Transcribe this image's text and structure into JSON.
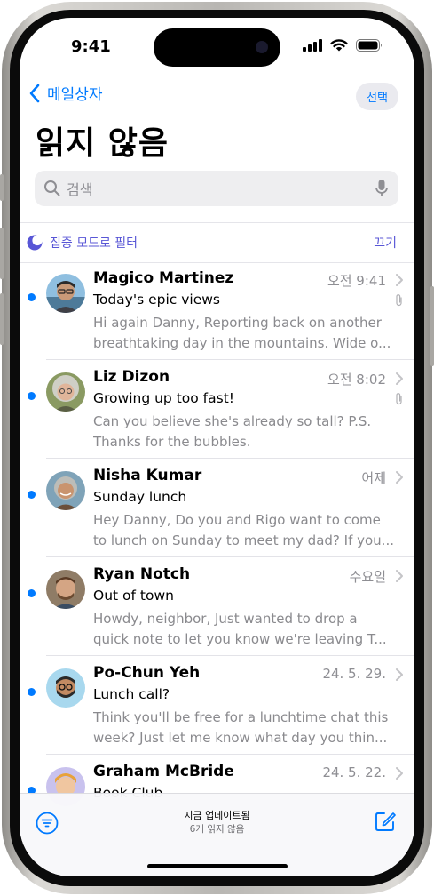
{
  "status": {
    "time": "9:41"
  },
  "nav": {
    "back_label": "메일상자",
    "select_label": "선택",
    "title": "읽지 않음"
  },
  "search": {
    "placeholder": "검색"
  },
  "focus_filter": {
    "label": "집중 모드로 필터",
    "off_label": "끄기"
  },
  "messages": [
    {
      "sender": "Magico Martinez",
      "date": "오전 9:41",
      "subject": "Today's epic views",
      "preview1": "Hi again Danny, Reporting back on another",
      "preview2": "breathtaking day in the mountains. Wide o...",
      "unread": true,
      "attachment": true
    },
    {
      "sender": "Liz Dizon",
      "date": "오전 8:02",
      "subject": "Growing up too fast!",
      "preview1": "Can you believe she's already so tall? P.S.",
      "preview2": "Thanks for the bubbles.",
      "unread": true,
      "attachment": true
    },
    {
      "sender": "Nisha Kumar",
      "date": "어제",
      "subject": "Sunday lunch",
      "preview1": "Hey Danny, Do you and Rigo want to come",
      "preview2": "to lunch on Sunday to meet my dad? If you...",
      "unread": true,
      "attachment": false
    },
    {
      "sender": "Ryan Notch",
      "date": "수요일",
      "subject": "Out of town",
      "preview1": "Howdy, neighbor, Just wanted to drop a",
      "preview2": "quick note to let you know we're leaving T...",
      "unread": true,
      "attachment": false
    },
    {
      "sender": "Po-Chun Yeh",
      "date": "24. 5. 29.",
      "subject": "Lunch call?",
      "preview1": "Think you'll be free for a lunchtime chat this",
      "preview2": "week? Just let me know what day you thin...",
      "unread": true,
      "attachment": false
    },
    {
      "sender": "Graham McBride",
      "date": "24. 5. 22.",
      "subject": "Book Club",
      "preview1": "",
      "preview2": "",
      "unread": true,
      "attachment": false
    }
  ],
  "toolbar": {
    "status": "지금 업데이트됨",
    "unread_count": "6개 읽지 않음"
  },
  "colors": {
    "accent": "#007aff",
    "focus": "#5856d6",
    "unread_dot": "#007aff"
  }
}
